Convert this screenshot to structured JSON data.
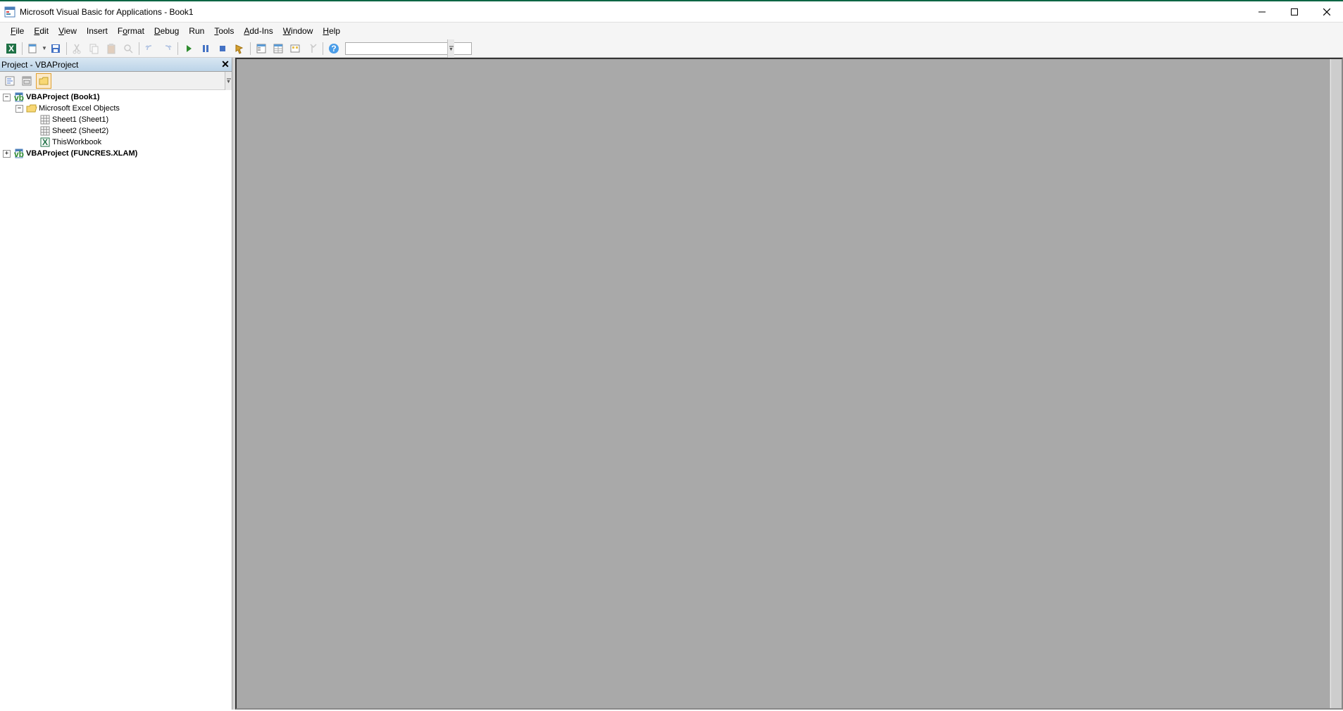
{
  "title": "Microsoft Visual Basic for Applications - Book1",
  "menus": {
    "file": "File",
    "edit": "Edit",
    "view": "View",
    "insert": "Insert",
    "format": "Format",
    "debug": "Debug",
    "run": "Run",
    "tools": "Tools",
    "addins": "Add-Ins",
    "window": "Window",
    "help": "Help"
  },
  "project_panel": {
    "title": "Project - VBAProject",
    "tree": {
      "root1": "VBAProject (Book1)",
      "excel_objects": "Microsoft Excel Objects",
      "sheet1": "Sheet1 (Sheet1)",
      "sheet2": "Sheet2 (Sheet2)",
      "thisworkbook": "ThisWorkbook",
      "root2": "VBAProject (FUNCRES.XLAM)"
    }
  }
}
